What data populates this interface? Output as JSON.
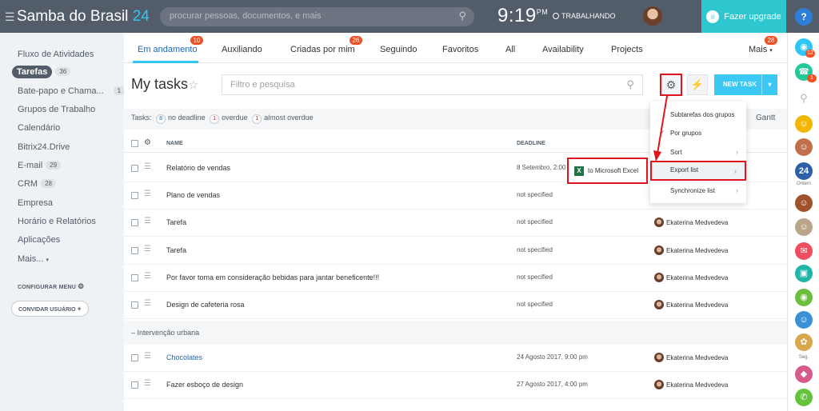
{
  "topbar": {
    "brand_name": "Samba do Brasil",
    "brand_number": "24",
    "search_placeholder": "procurar pessoas, documentos, e mais",
    "time": "9:19",
    "time_suffix": "PM",
    "status": "TRABALHANDO",
    "upgrade_label": "Fazer upgrade",
    "help_label": "?"
  },
  "sidebar": {
    "items": [
      {
        "label": "Fluxo de Atividades",
        "badge": ""
      },
      {
        "label": "Tarefas",
        "badge": "36"
      },
      {
        "label": "Bate-papo e Chama...",
        "badge": "1"
      },
      {
        "label": "Grupos de Trabalho",
        "badge": ""
      },
      {
        "label": "Calendário",
        "badge": ""
      },
      {
        "label": "Bitrix24.Drive",
        "badge": ""
      },
      {
        "label": "E-mail",
        "badge": "29"
      },
      {
        "label": "CRM",
        "badge": "28"
      },
      {
        "label": "Empresa",
        "badge": ""
      },
      {
        "label": "Horário e Relatórios",
        "badge": ""
      },
      {
        "label": "Aplicações",
        "badge": ""
      },
      {
        "label": "Mais...",
        "badge": ""
      }
    ],
    "config_label": "CONFIGURAR MENU",
    "invite_label": "CONVIDAR USUÁRIO"
  },
  "tabs": [
    {
      "label": "Em andamento",
      "badge": "10"
    },
    {
      "label": "Auxiliando",
      "badge": ""
    },
    {
      "label": "Criadas por mim",
      "badge": "26"
    },
    {
      "label": "Seguindo",
      "badge": ""
    },
    {
      "label": "Favoritos",
      "badge": ""
    },
    {
      "label": "All",
      "badge": ""
    },
    {
      "label": "Availability",
      "badge": ""
    },
    {
      "label": "Projects",
      "badge": ""
    },
    {
      "label": "Mais",
      "badge": "28"
    }
  ],
  "toolbar": {
    "title": "My tasks",
    "filter_placeholder": "Filtro e pesquisa",
    "new_task_label": "NEW TASK"
  },
  "counters": {
    "prefix": "Tasks:",
    "no_deadline_count": "8",
    "no_deadline_label": "no deadline",
    "overdue_count": "1",
    "overdue_label": "overdue",
    "almost_count": "1",
    "almost_label": "almost overdue",
    "gantt_label": "Gantt"
  },
  "table": {
    "col_name": "NAME",
    "col_deadline": "DEADLINE",
    "rows": [
      {
        "name": "Relatório de vendas",
        "deadline": "8 Setembro, 2:00",
        "responsible": ""
      },
      {
        "name": "Plano de vendas",
        "deadline": "not specified",
        "responsible": ""
      },
      {
        "name": "Tarefa",
        "deadline": "not specified",
        "responsible": "Ekaterina Medvedeva"
      },
      {
        "name": "Tarefa",
        "deadline": "not specified",
        "responsible": "Ekaterina Medvedeva"
      },
      {
        "name": "Por favor toma em consideração bebidas para jantar beneficente!!!",
        "deadline": "not specified",
        "responsible": "Ekaterina Medvedeva"
      },
      {
        "name": "Design de cafeteria rosa",
        "deadline": "not specified",
        "responsible": "Ekaterina Medvedeva"
      }
    ],
    "group_label": "Intervenção urbana",
    "group_rows": [
      {
        "name": "Chocolates",
        "deadline": "24 Agosto 2017, 9:00 pm",
        "responsible": "Ekaterina Medvedeva"
      },
      {
        "name": "Fazer esboço de design",
        "deadline": "27 Agosto 2017, 4:00 pm",
        "responsible": "Ekaterina Medvedeva"
      }
    ]
  },
  "menu": {
    "items": [
      {
        "label": "Subtarefas dos grupos"
      },
      {
        "label": "Por grupos"
      },
      {
        "label": "Sort"
      },
      {
        "label": "Export list"
      },
      {
        "label": "Synchronize list"
      }
    ],
    "submenu_label": "to Microsoft Excel",
    "submenu_icon_letter": "X"
  },
  "rail": {
    "notif_badge": "12",
    "chat_badge": "1",
    "label_24": "24",
    "label_ontem": "Ontem",
    "label_seg": "Seg."
  },
  "colors": {
    "topbar": "#535c69",
    "accent": "#2fc6f6",
    "upgrade": "#2fc7cf",
    "highlight": "#e0141e",
    "badge": "#f04e23"
  }
}
